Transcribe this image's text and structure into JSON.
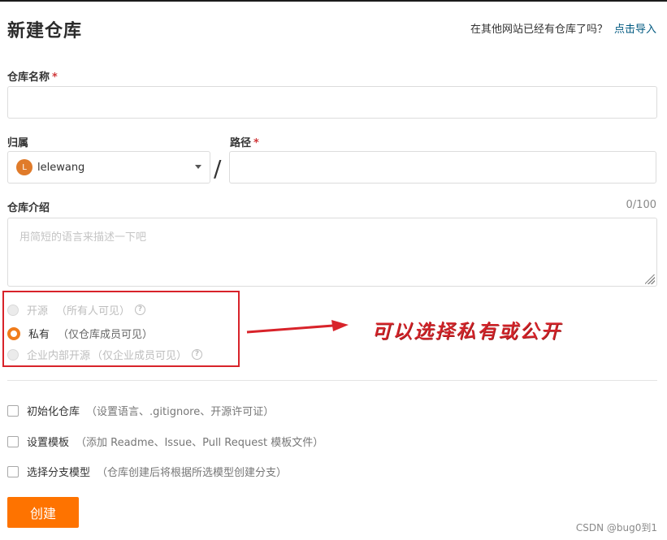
{
  "header": {
    "title": "新建仓库",
    "import_prompt": "在其他网站已经有仓库了吗？",
    "import_link": "点击导入"
  },
  "form": {
    "repo_name": {
      "label": "仓库名称",
      "required_mark": "*",
      "value": ""
    },
    "owner": {
      "label": "归属",
      "avatar_letter": "L",
      "selected": "lelewang"
    },
    "separator": "/",
    "path": {
      "label": "路径",
      "required_mark": "*",
      "value": ""
    },
    "description": {
      "label": "仓库介绍",
      "counter": "0/100",
      "placeholder": "用简短的语言来描述一下吧"
    },
    "visibility": [
      {
        "label": "开源",
        "desc": "（所有人可见）",
        "help": "?",
        "checked": false,
        "disabled": true
      },
      {
        "label": "私有",
        "desc": "（仅仓库成员可见）",
        "help": "",
        "checked": true,
        "disabled": false
      },
      {
        "label": "企业内部开源",
        "desc": "（仅企业成员可见）",
        "help": "?",
        "checked": false,
        "disabled": true
      }
    ],
    "options": [
      {
        "label": "初始化仓库",
        "desc": "（设置语言、.gitignore、开源许可证）",
        "checked": false
      },
      {
        "label": "设置模板",
        "desc": "（添加 Readme、Issue、Pull Request 模板文件）",
        "checked": false
      },
      {
        "label": "选择分支模型",
        "desc": "（仓库创建后将根据所选模型创建分支）",
        "checked": false
      }
    ],
    "submit_label": "创建"
  },
  "annotation": {
    "text": "可以选择私有或公开",
    "color": "#d8232a"
  },
  "watermark": "CSDN @bug0到1",
  "colors": {
    "accent": "#fe7300",
    "link": "#005980",
    "required": "#d0383a"
  }
}
